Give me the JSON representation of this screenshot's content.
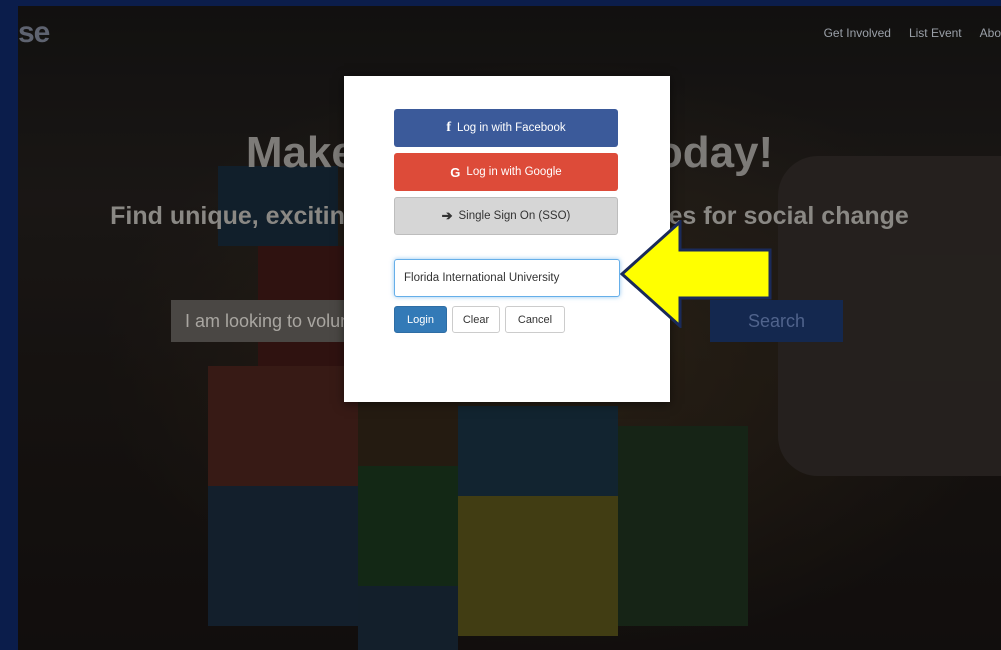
{
  "site": {
    "logo": "se",
    "nav": [
      "Get Involved",
      "List Event",
      "Abo"
    ]
  },
  "hero": {
    "title": "Make a Difference Today!",
    "subtitle": "Find unique, exciting and impactful opportunities for social change",
    "search_placeholder": "I am looking to volunteer",
    "search_button": "Search"
  },
  "modal": {
    "facebook": {
      "icon": "facebook-f-icon",
      "glyph": "f",
      "label": "Log in with Facebook",
      "color": "#3b5a9a"
    },
    "google": {
      "icon": "google-g-icon",
      "glyph": "G",
      "label": "Log in with Google",
      "color": "#dd4b39"
    },
    "sso": {
      "icon": "sign-in-icon",
      "glyph": "➔",
      "label": "Single Sign On (SSO)"
    },
    "institution_value": "Florida International University",
    "login": "Login",
    "clear": "Clear",
    "cancel": "Cancel"
  },
  "annotation": {
    "icon": "yellow-arrow-icon",
    "color": "#ffff00"
  }
}
